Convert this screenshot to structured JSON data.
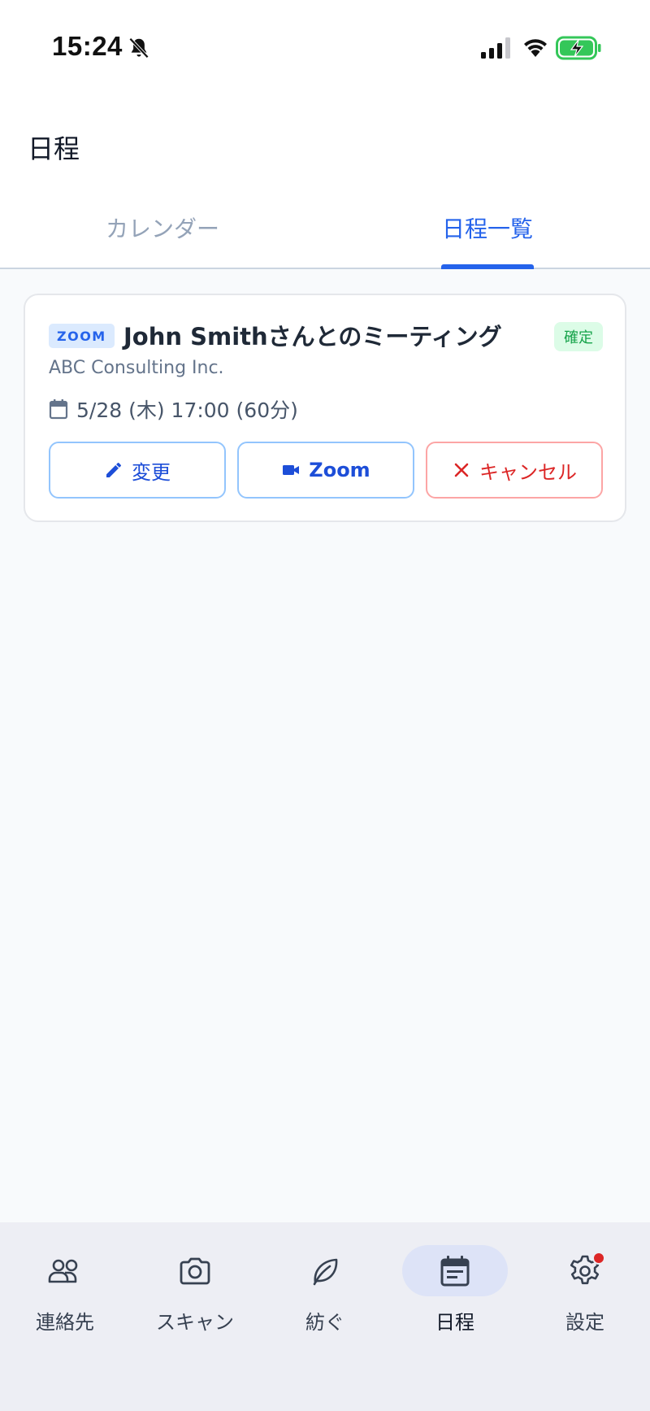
{
  "status_bar": {
    "time": "15:24"
  },
  "header": {
    "title": "日程"
  },
  "tabs": [
    {
      "label": "カレンダー",
      "active": false
    },
    {
      "label": "日程一覧",
      "active": true
    }
  ],
  "event": {
    "platform_tag": "ZOOM",
    "title": "John Smithさんとのミーティング",
    "status": "確定",
    "company": "ABC Consulting Inc.",
    "datetime": "5/28 (木) 17:00 (60分)",
    "actions": {
      "edit_label": "変更",
      "zoom_label": "Zoom",
      "cancel_label": "キャンセル"
    }
  },
  "bottom_nav": [
    {
      "label": "連絡先",
      "icon": "contacts-icon",
      "active": false
    },
    {
      "label": "スキャン",
      "icon": "camera-icon",
      "active": false
    },
    {
      "label": "紡ぐ",
      "icon": "leaf-icon",
      "active": false
    },
    {
      "label": "日程",
      "icon": "calendar-icon",
      "active": true
    },
    {
      "label": "設定",
      "icon": "gear-icon",
      "active": false,
      "notification_dot": true
    }
  ],
  "colors": {
    "accent": "#2563eb",
    "danger": "#dc2626",
    "success": "#16a34a"
  }
}
